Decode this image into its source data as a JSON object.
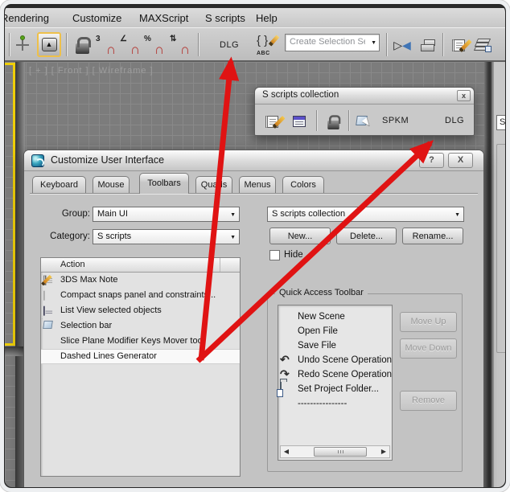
{
  "colors": {
    "arrow_red": "#e01313",
    "active_viewport_border": "#f0cf08",
    "dialog_gray": "#c3c3c3",
    "viewport_gray": "#7c7c7c"
  },
  "menubar": {
    "items": [
      "Rendering",
      "Customize",
      "MAXScript",
      "S scripts",
      "Help"
    ]
  },
  "toolbar": {
    "dlg_button": "DLG",
    "selection_set_value": "Create Selection Se"
  },
  "icons": {
    "combo_arrow": "▼",
    "key_arrow": "▲",
    "magnet": "∩",
    "snap_3d_label": "3",
    "angle_snap_label": "∠",
    "percent_snap_label": "%",
    "spinner_snap_label": "⇅",
    "braces": "{ }",
    "abc_label": "ABC",
    "mirror_left": "▷",
    "mirror_right": "◀",
    "undo": "↶",
    "redo": "↷",
    "scroll_left": "◀",
    "scroll_right": "▶"
  },
  "viewport": {
    "label": "[ + ] [ Front ] [ Wireframe ]"
  },
  "floating_toolbar": {
    "title": "S scripts collection",
    "close": "x",
    "spkm_button": "SPKM",
    "dlg_button": "DLG"
  },
  "right_panel": {
    "field_value": "S"
  },
  "dialog": {
    "title": "Customize User Interface",
    "help": "?",
    "close": "X",
    "tabs": [
      "Keyboard",
      "Mouse",
      "Toolbars",
      "Quads",
      "Menus",
      "Colors"
    ],
    "active_tab": "Toolbars",
    "group_label": "Group:",
    "group_value": "Main UI",
    "category_label": "Category:",
    "category_value": "S scripts",
    "collection_value": "S scripts collection",
    "new_button": "New...",
    "delete_button": "Delete...",
    "rename_button": "Rename...",
    "hide_label": "Hide",
    "action_header": "Action",
    "actions": [
      "3DS Max Note",
      "Compact snaps panel and constraints...",
      "List View selected objects",
      "Selection bar",
      "Slice Plane Modifier Keys Mover tool",
      "Dashed Lines Generator"
    ],
    "selected_action": "Dashed Lines Generator",
    "qat": {
      "title": "Quick Access Toolbar",
      "items": [
        "New Scene",
        "Open File",
        "Save File",
        "Undo Scene Operation",
        "Redo Scene Operation",
        "Set Project Folder...",
        "----------------"
      ],
      "move_up": "Move Up",
      "move_down": "Move Down",
      "remove": "Remove"
    }
  }
}
